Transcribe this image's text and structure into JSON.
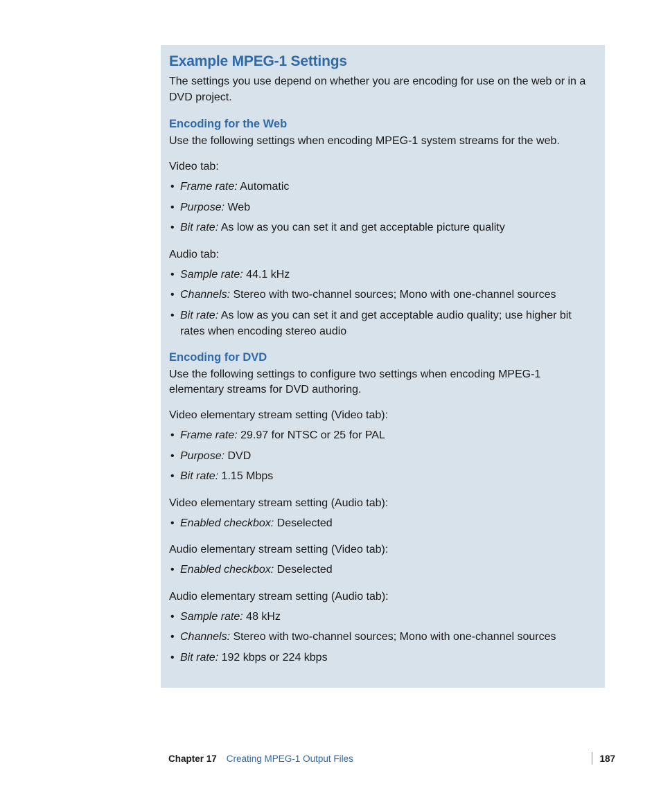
{
  "box": {
    "title": "Example MPEG-1 Settings",
    "intro": "The settings you use depend on whether you are encoding for use on the web or in a DVD project.",
    "web": {
      "heading": "Encoding for the Web",
      "lead": "Use the following settings when encoding MPEG-1 system streams for the web.",
      "video_tab_label": "Video tab:",
      "video_items": [
        {
          "label": "Frame rate:",
          "value": "  Automatic"
        },
        {
          "label": "Purpose:",
          "value": "  Web"
        },
        {
          "label": "Bit rate:",
          "value": "  As low as you can set it and get acceptable picture quality"
        }
      ],
      "audio_tab_label": "Audio tab:",
      "audio_items": [
        {
          "label": "Sample rate:",
          "value": "  44.1 kHz"
        },
        {
          "label": "Channels:",
          "value": "  Stereo with two-channel sources; Mono with one-channel sources"
        },
        {
          "label": "Bit rate:",
          "value": "  As low as you can set it and get acceptable audio quality; use higher bit rates when encoding stereo audio"
        }
      ]
    },
    "dvd": {
      "heading": "Encoding for DVD",
      "lead": "Use the following settings to configure two settings when encoding MPEG-1 elementary streams for DVD authoring.",
      "ves_video_label": "Video elementary stream setting (Video tab):",
      "ves_video_items": [
        {
          "label": "Frame rate:",
          "value": "  29.97 for NTSC or 25 for PAL"
        },
        {
          "label": "Purpose:",
          "value": "  DVD"
        },
        {
          "label": "Bit rate:",
          "value": "  1.15 Mbps"
        }
      ],
      "ves_audio_label": "Video elementary stream setting (Audio tab):",
      "ves_audio_items": [
        {
          "label": "Enabled checkbox:",
          "value": "  Deselected"
        }
      ],
      "aes_video_label": "Audio elementary stream setting (Video tab):",
      "aes_video_items": [
        {
          "label": "Enabled checkbox:",
          "value": "  Deselected"
        }
      ],
      "aes_audio_label": "Audio elementary stream setting (Audio tab):",
      "aes_audio_items": [
        {
          "label": "Sample rate:",
          "value": "  48 kHz"
        },
        {
          "label": "Channels:",
          "value": "  Stereo with two-channel sources; Mono with one-channel sources"
        },
        {
          "label": "Bit rate:",
          "value": "  192 kbps or 224 kbps"
        }
      ]
    }
  },
  "footer": {
    "chapter_label": "Chapter 17",
    "chapter_title": "Creating MPEG-1 Output Files",
    "page_number": "187"
  }
}
